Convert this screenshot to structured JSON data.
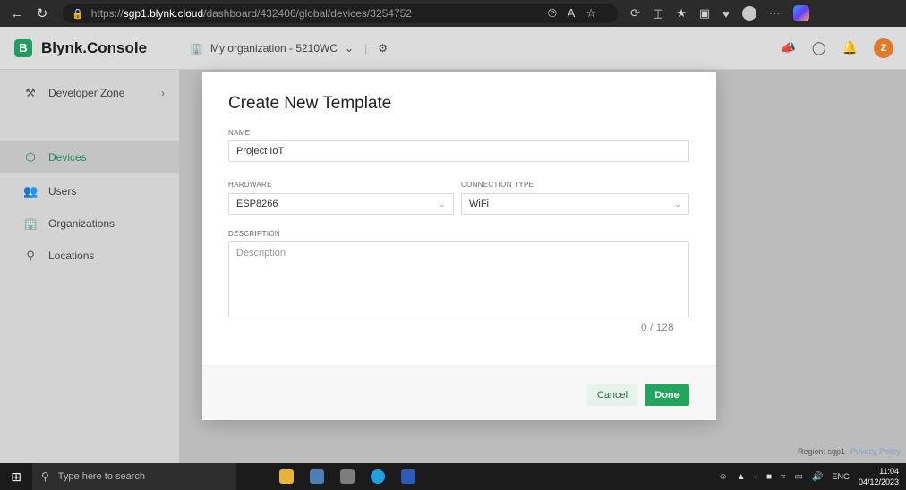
{
  "browser": {
    "url_prefix": "https://",
    "url_host": "sgp1.blynk.cloud",
    "url_path": "/dashboard/432406/global/devices/3254752"
  },
  "header": {
    "brand_mark": "B",
    "brand_name": "Blynk.Console",
    "organization": "My organization - 5210WC",
    "avatar_initial": "Z"
  },
  "sidebar": {
    "items": [
      {
        "label": "Developer Zone"
      },
      {
        "label": "Devices"
      },
      {
        "label": "Users"
      },
      {
        "label": "Organizations"
      },
      {
        "label": "Locations"
      }
    ]
  },
  "modal": {
    "title": "Create New Template",
    "name_label": "NAME",
    "name_value": "Project IoT",
    "hardware_label": "HARDWARE",
    "hardware_value": "ESP8266",
    "connection_label": "CONNECTION TYPE",
    "connection_value": "WiFi",
    "description_label": "DESCRIPTION",
    "description_placeholder": "Description",
    "counter": "0 / 128",
    "cancel_label": "Cancel",
    "done_label": "Done"
  },
  "footer": {
    "region": "Region: sgp1",
    "privacy": "Privacy Policy"
  },
  "taskbar": {
    "search_placeholder": "Type here to search",
    "lang": "ENG",
    "time": "11:04",
    "date": "04/12/2023"
  },
  "colors": {
    "brand_green": "#23a45f",
    "active_green": "#1f8f57"
  }
}
